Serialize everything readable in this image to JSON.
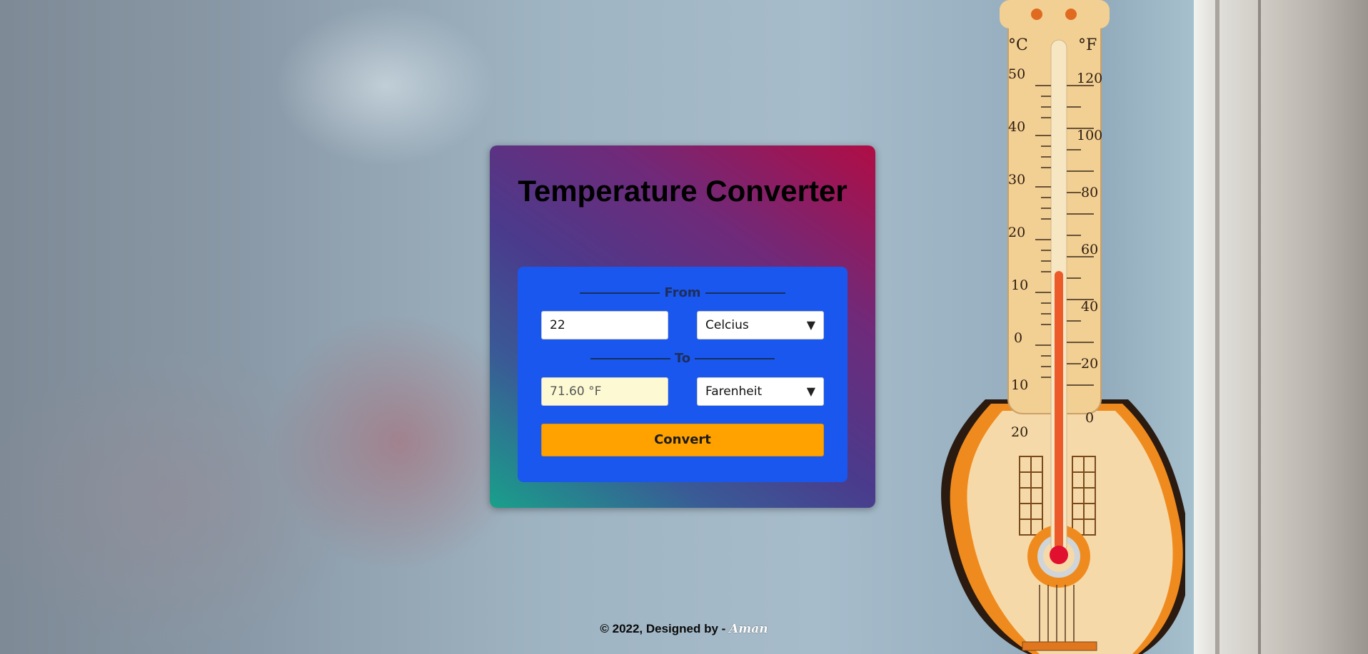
{
  "app": {
    "title": "Temperature Converter"
  },
  "from": {
    "label": "From",
    "value": "22",
    "unit": "Celcius"
  },
  "to": {
    "label": "To",
    "value": "71.60 °F",
    "unit": "Farenheit"
  },
  "convert_label": "Convert",
  "footer": {
    "text": "© 2022, Designed by - ",
    "author": "Aman"
  },
  "thermometer": {
    "celsius_label": "°C",
    "fahrenheit_label": "°F",
    "celsius_ticks": [
      "50",
      "40",
      "30",
      "20",
      "10",
      "0",
      "10",
      "20"
    ],
    "fahrenheit_ticks": [
      "120",
      "100",
      "80",
      "60",
      "40",
      "20",
      "0"
    ]
  },
  "icons": {
    "dropdown": "triangle-down-icon"
  },
  "colors": {
    "panel": "#1a57ee",
    "button": "#ffa200",
    "result_bg": "#fdfad3"
  }
}
